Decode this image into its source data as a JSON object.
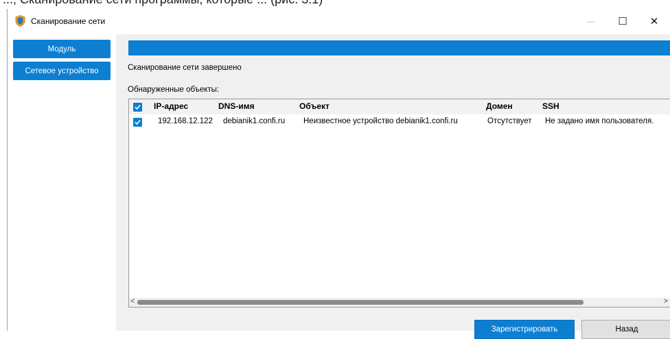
{
  "background_text": "...; Сканирование сети программы, которые ... (рис. 3.1)",
  "window": {
    "title": "Сканирование сети",
    "controls": {
      "minimize": "—",
      "maximize": "☐",
      "close": "✕"
    }
  },
  "sidebar": {
    "items": [
      {
        "label": "Модуль"
      },
      {
        "label": "Сетевое устройство"
      }
    ]
  },
  "main": {
    "progress_percent": 100,
    "status": "Сканирование сети завершено",
    "found_label": "Обнаруженные объекты:",
    "table": {
      "columns": [
        "IP-адрес",
        "DNS-имя",
        "Объект",
        "Домен",
        "SSH"
      ],
      "rows": [
        {
          "checked": true,
          "ip": "192.168.12.122",
          "dns": "debianik1.confi.ru",
          "object": "Неизвестное устройство debianik1.confi.ru",
          "domain": "Отсутствует",
          "ssh": "Не задано имя пользователя."
        }
      ],
      "header_checked": true
    },
    "scroll": {
      "left_arrow": "<",
      "right_arrow": ">"
    }
  },
  "buttons": {
    "register": "Зарегистрировать",
    "back": "Назад"
  },
  "colors": {
    "accent": "#0c7fd2",
    "content_bg": "#f0f0f0"
  },
  "icons": [
    "shield-icon",
    "checkbox-icon",
    "minimize-icon",
    "maximize-icon",
    "close-icon"
  ]
}
